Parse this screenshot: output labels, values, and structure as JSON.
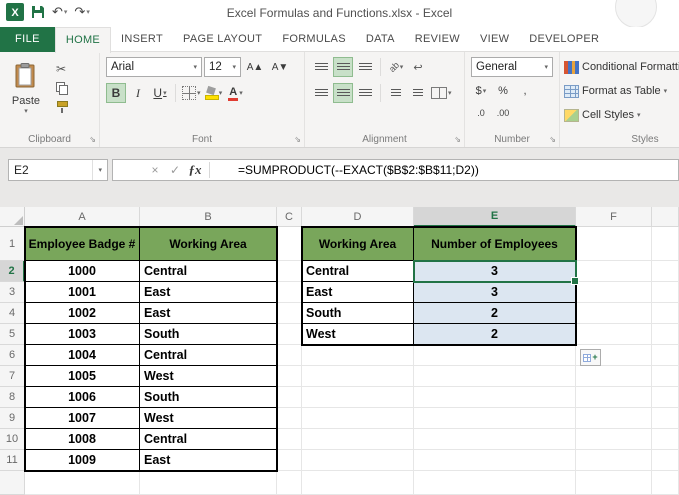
{
  "colors": {
    "excel_green": "#217346",
    "header_fill": "#79A65B",
    "blue_fill": "#DCE6F1",
    "active_toggle": "#C8E0C8"
  },
  "titlebar": {
    "title": "Excel Formulas and Functions.xlsx - Excel"
  },
  "tabs": {
    "file": "FILE",
    "items": [
      "HOME",
      "INSERT",
      "PAGE LAYOUT",
      "FORMULAS",
      "DATA",
      "REVIEW",
      "VIEW",
      "DEVELOPER"
    ],
    "active": "HOME"
  },
  "ribbon": {
    "paste": "Paste",
    "font_name": "Arial",
    "font_size": "12",
    "number_format": "General",
    "styles_buttons": [
      "Conditional Formatting",
      "Format as Table",
      "Cell Styles"
    ],
    "group_labels": [
      "Clipboard",
      "Font",
      "Alignment",
      "Number",
      "Styles"
    ]
  },
  "formula_bar": {
    "name_box": "E2",
    "formula": "=SUMPRODUCT(--EXACT($B$2:$B$11;D2))"
  },
  "grid": {
    "column_headers": [
      "A",
      "B",
      "C",
      "D",
      "E",
      "F"
    ],
    "row_headers": [
      "1",
      "2",
      "3",
      "4",
      "5",
      "6",
      "7",
      "8",
      "9",
      "10",
      "11"
    ],
    "selected_cell": "E2",
    "selected_column": "E",
    "selected_row": 2,
    "table1": {
      "headers": [
        "Employee Badge #",
        "Working Area"
      ],
      "rows": [
        [
          "1000",
          "Central"
        ],
        [
          "1001",
          "East"
        ],
        [
          "1002",
          "East"
        ],
        [
          "1003",
          "South"
        ],
        [
          "1004",
          "Central"
        ],
        [
          "1005",
          "West"
        ],
        [
          "1006",
          "South"
        ],
        [
          "1007",
          "West"
        ],
        [
          "1008",
          "Central"
        ],
        [
          "1009",
          "East"
        ]
      ]
    },
    "table2": {
      "headers": [
        "Working Area",
        "Number of Employees"
      ],
      "rows": [
        [
          "Central",
          "3"
        ],
        [
          "East",
          "3"
        ],
        [
          "South",
          "2"
        ],
        [
          "West",
          "2"
        ]
      ]
    }
  },
  "icons": {
    "chevron_down": "▾",
    "cut": "✂",
    "undo": "↶",
    "redo": "↷",
    "cancel": "×",
    "enter": "✓",
    "insert_function": "ƒx",
    "wrap_text": "↩",
    "orientation": "ab",
    "dollar": "$",
    "percent": "%",
    "comma": ",",
    "increase_decimal": ".0",
    "decrease_decimal": ".00",
    "bold": "B",
    "italic": "I",
    "underline": "U",
    "increase_font": "A▲",
    "decrease_font": "A▼",
    "font_color": "A",
    "launcher": "⇘",
    "autofill_plus": "+"
  }
}
